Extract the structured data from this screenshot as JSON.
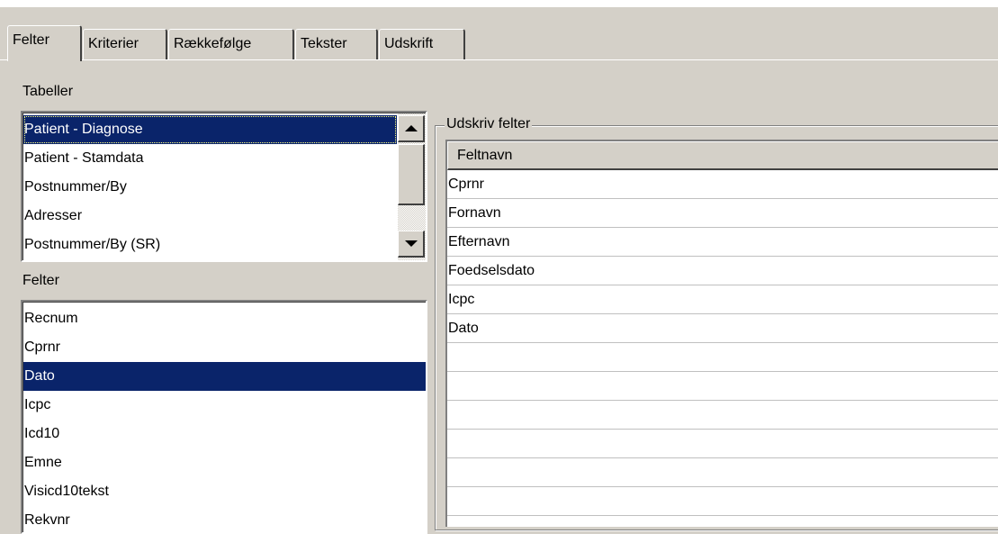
{
  "tabs": [
    "Felter",
    "Kriterier",
    "Rækkefølge",
    "Tekster",
    "Udskrift"
  ],
  "tabeller": {
    "label": "Tabeller",
    "items": [
      "Patient - Diagnose",
      "Patient - Stamdata",
      "Postnummer/By",
      "Adresser",
      "Postnummer/By (SR)"
    ],
    "selected": "Patient - Diagnose"
  },
  "felter": {
    "label": "Felter",
    "items": [
      "Recnum",
      "Cprnr",
      "Dato",
      "Icpc",
      "Icd10",
      "Emne",
      "Visicd10tekst",
      "Rekvnr"
    ],
    "selected": "Dato"
  },
  "udskriv": {
    "label": "Udskriv felter",
    "column": "Feltnavn",
    "rows": [
      "Cprnr",
      "Fornavn",
      "Efternavn",
      "Foedselsdato",
      "Icpc",
      "Dato"
    ]
  },
  "colors": {
    "selection": "#0a246a",
    "face": "#d4d0c8"
  }
}
